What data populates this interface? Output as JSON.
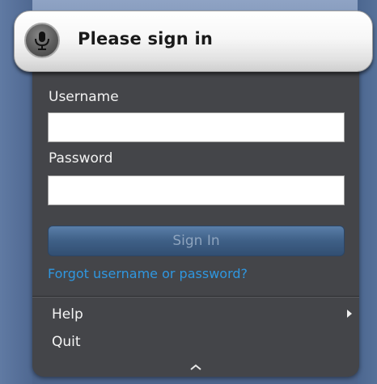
{
  "header": {
    "title": "Please sign in",
    "icon": "microphone-icon"
  },
  "form": {
    "username_label": "Username",
    "username_value": "",
    "password_label": "Password",
    "password_value": "",
    "signin_label": "Sign In",
    "forgot_link": "Forgot username or password?"
  },
  "menu": {
    "items": [
      {
        "label": "Help",
        "has_submenu": true,
        "icon": "chevron-right-icon"
      },
      {
        "label": "Quit",
        "has_submenu": false
      }
    ],
    "collapse_icon": "chevron-up-icon"
  },
  "colors": {
    "panel_bg": "#444549",
    "link": "#2f97e0",
    "signin_button": "#3e5f86"
  }
}
